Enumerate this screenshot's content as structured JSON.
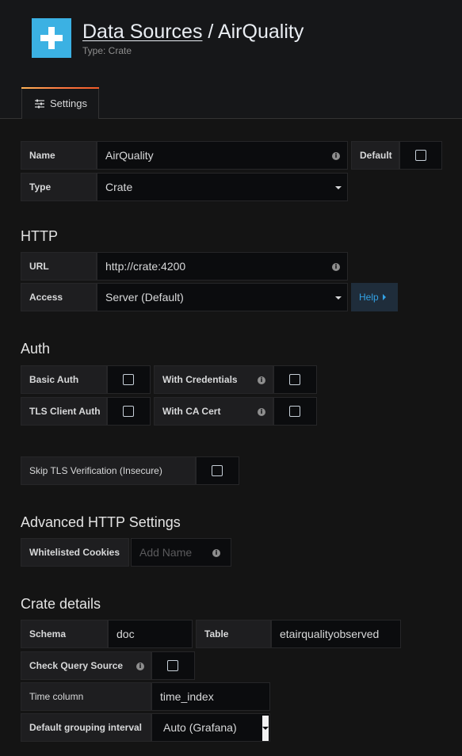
{
  "header": {
    "breadcrumb_link": "Data Sources",
    "separator": "/",
    "title": "AirQuality",
    "subtitle": "Type: Crate"
  },
  "tabs": [
    {
      "label": "Settings",
      "icon": "sliders-icon"
    }
  ],
  "general": {
    "name_label": "Name",
    "name_value": "AirQuality",
    "default_label": "Default",
    "default_checked": false,
    "type_label": "Type",
    "type_value": "Crate"
  },
  "http": {
    "title": "HTTP",
    "url_label": "URL",
    "url_value": "http://crate:4200",
    "access_label": "Access",
    "access_value": "Server (Default)",
    "help_label": "Help"
  },
  "auth": {
    "title": "Auth",
    "basic_auth": "Basic Auth",
    "with_credentials": "With Credentials",
    "tls_client_auth": "TLS Client Auth",
    "with_ca_cert": "With CA Cert",
    "skip_tls": "Skip TLS Verification (Insecure)"
  },
  "advanced": {
    "title": "Advanced HTTP Settings",
    "whitelisted_cookies_label": "Whitelisted Cookies",
    "add_name_placeholder": "Add Name"
  },
  "crate": {
    "title": "Crate details",
    "schema_label": "Schema",
    "schema_value": "doc",
    "table_label": "Table",
    "table_value": "etairqualityobserved",
    "check_query_source_label": "Check Query Source",
    "time_column_label": "Time column",
    "time_column_value": "time_index",
    "grouping_label": "Default grouping interval",
    "grouping_value": "Auto (Grafana)"
  },
  "colors": {
    "background": "#161719",
    "input_bg": "#0b0c0e",
    "label_bg": "#1e1e20",
    "logo": "#3bb1e3",
    "link": "#33a2e5",
    "tab_accent": "#ff7941"
  }
}
